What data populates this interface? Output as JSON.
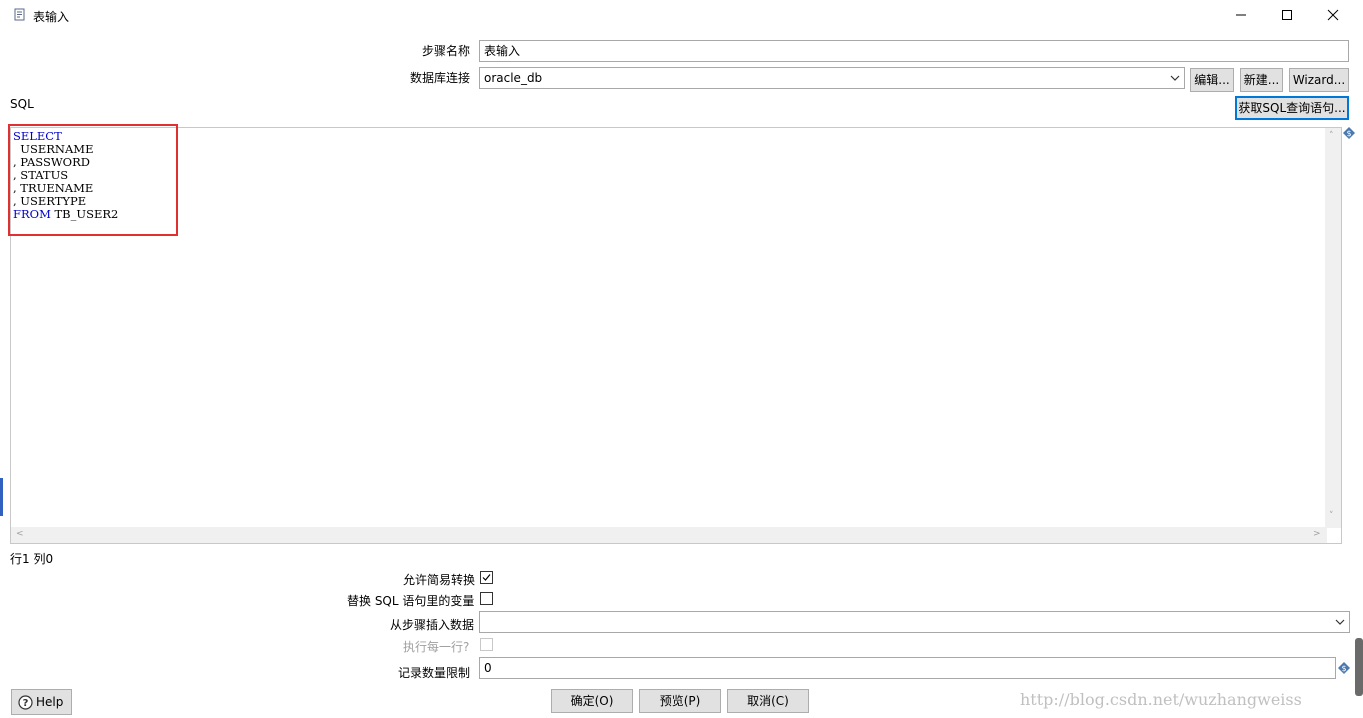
{
  "window": {
    "title": "表输入",
    "icon": "table-input-icon"
  },
  "form": {
    "step_name_label": "步骤名称",
    "step_name_value": "表输入",
    "db_conn_label": "数据库连接",
    "db_conn_value": "oracle_db",
    "edit_button": "编辑...",
    "new_button": "新建...",
    "wizard_button": "Wizard...",
    "sql_label": "SQL",
    "get_sql_button": "获取SQL查询语句..."
  },
  "sql": {
    "lines": [
      {
        "kw": "SELECT",
        "rest": ""
      },
      {
        "kw": "",
        "rest": "  USERNAME"
      },
      {
        "kw": "",
        "rest": ", PASSWORD"
      },
      {
        "kw": "",
        "rest": ", STATUS"
      },
      {
        "kw": "",
        "rest": ", TRUENAME"
      },
      {
        "kw": "",
        "rest": ", USERTYPE"
      },
      {
        "kw": "FROM",
        "rest": " TB_USER2"
      }
    ]
  },
  "status": {
    "position": "行1 列0"
  },
  "options": {
    "lazy_conversion_label": "允许简易转换",
    "lazy_conversion_checked": true,
    "replace_vars_label": "替换 SQL 语句里的变量",
    "replace_vars_checked": false,
    "insert_from_step_label": "从步骤插入数据",
    "insert_from_step_value": "",
    "execute_each_row_label": "执行每一行?",
    "execute_each_row_checked": false,
    "limit_label": "记录数量限制",
    "limit_value": "0"
  },
  "footer": {
    "help_button": "Help",
    "ok_button": "确定(O)",
    "preview_button": "预览(P)",
    "cancel_button": "取消(C)"
  },
  "watermark": "http://blog.csdn.net/wuzhangweiss",
  "colors": {
    "keyword": "#0000cc",
    "highlight_box": "#e03030",
    "focus_border": "#0078d7"
  }
}
